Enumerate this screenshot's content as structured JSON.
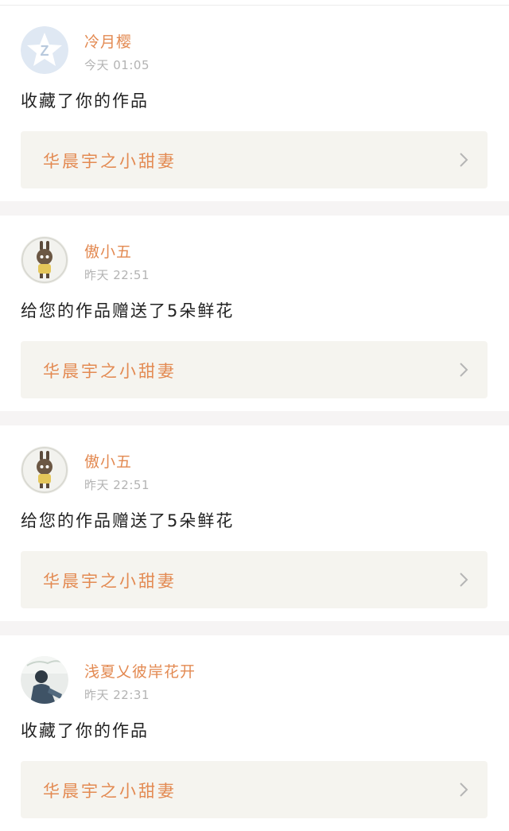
{
  "colors": {
    "accent": "#e38a52",
    "time_text": "#b3b3b3",
    "work_card_bg": "#f5f4ef",
    "separator": "#f6f4f4"
  },
  "notifications": [
    {
      "username": "冷月樱",
      "time": "今天 01:05",
      "action": "收藏了你的作品",
      "work_title": "华晨宇之小甜妻",
      "avatar": "qzone-star-icon"
    },
    {
      "username": "傲小五",
      "time": "昨天 22:51",
      "action": "给您的作品赠送了5朵鲜花",
      "work_title": "华晨宇之小甜妻",
      "avatar": "bunny-figure-icon"
    },
    {
      "username": "傲小五",
      "time": "昨天 22:51",
      "action": "给您的作品赠送了5朵鲜花",
      "work_title": "华晨宇之小甜妻",
      "avatar": "bunny-figure-icon"
    },
    {
      "username": "浅夏乂彼岸花开",
      "time": "昨天 22:31",
      "action": "收藏了你的作品",
      "work_title": "华晨宇之小甜妻",
      "avatar": "photo-person-icon"
    }
  ]
}
